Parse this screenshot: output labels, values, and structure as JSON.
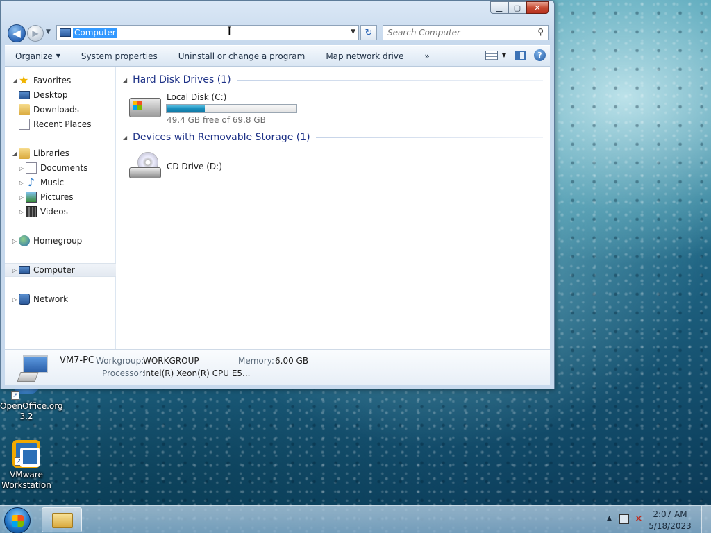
{
  "desktop": {
    "icons": [
      {
        "label": "OpenOffice.org 3.2"
      },
      {
        "label": "VMware Workstation"
      }
    ]
  },
  "window": {
    "caption": {
      "min": "▁",
      "max": "▢",
      "close": "✕"
    },
    "nav": {
      "back": "◀",
      "forward": "▶",
      "history": "▼"
    },
    "address": {
      "value": "Computer",
      "dropdown": "▼"
    },
    "refresh": "↻",
    "search": {
      "placeholder": "Search Computer",
      "icon": "⚲"
    },
    "toolbar": {
      "organize": "Organize",
      "system_properties": "System properties",
      "uninstall": "Uninstall or change a program",
      "map_drive": "Map network drive",
      "more": "»",
      "view_dropdown": "▼",
      "help": "?"
    },
    "navpane": {
      "favorites": "Favorites",
      "desktop": "Desktop",
      "downloads": "Downloads",
      "recent": "Recent Places",
      "libraries": "Libraries",
      "documents": "Documents",
      "music": "Music",
      "pictures": "Pictures",
      "videos": "Videos",
      "homegroup": "Homegroup",
      "computer": "Computer",
      "network": "Network"
    },
    "groups": {
      "hdd": "Hard Disk Drives (1)",
      "removable": "Devices with Removable Storage (1)"
    },
    "drives": {
      "c": {
        "name": "Local Disk (C:)",
        "free": "49.4 GB free of 69.8 GB",
        "used_fraction": 0.292
      },
      "d": {
        "name": "CD Drive (D:)"
      }
    },
    "details": {
      "name": "VM7-PC",
      "workgroup_label": "Workgroup:",
      "workgroup": "WORKGROUP",
      "memory_label": "Memory:",
      "memory": "6.00 GB",
      "processor_label": "Processor:",
      "processor": "Intel(R) Xeon(R) CPU E5..."
    }
  },
  "taskbar": {
    "time": "2:07 AM",
    "date": "5/18/2023",
    "tray_arrow": "▲"
  },
  "colors": {
    "selection": "#3399ff",
    "group_title": "#1e3287",
    "capacity_bar": "#1a8fbd"
  }
}
